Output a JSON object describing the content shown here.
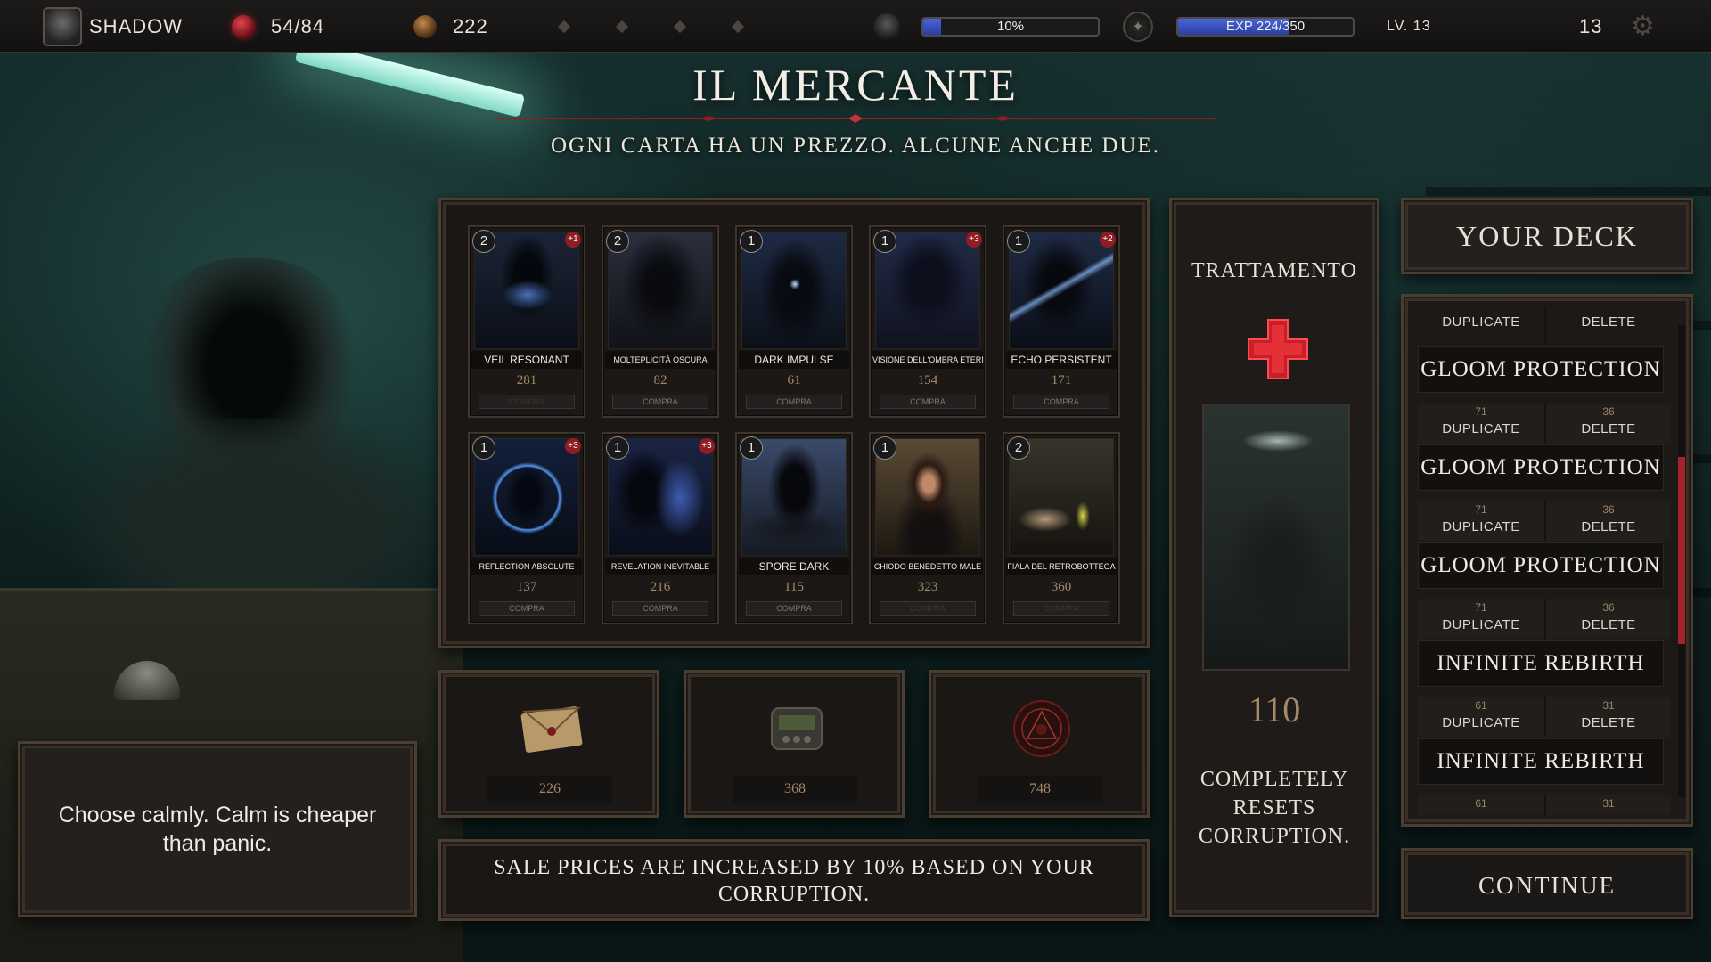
{
  "topbar": {
    "player_name": "SHADOW",
    "health": "54/84",
    "gold": "222",
    "corruption_label": "10%",
    "corruption_fraction": 0.1,
    "exp_label": "EXP 224/350",
    "exp_fraction": 0.64,
    "level_label": "LV. 13",
    "floor": "13",
    "icons": [
      "avatar",
      "heart-icon",
      "coin-icon",
      "diamond-icon",
      "mask-icon",
      "compass-icon",
      "gear-icon"
    ]
  },
  "header": {
    "title": "IL MERCANTE",
    "subtitle": "OGNI CARTA HA UN PREZZO. ALCUNE ANCHE DUE."
  },
  "shop": {
    "buy_label": "COMPRA",
    "cards": [
      {
        "name": "VEIL RESONANT",
        "cost": "2",
        "upgrade": "+1",
        "price": "281",
        "affordable": false,
        "art": "veil"
      },
      {
        "name": "MOLTEPLICITÀ OSCURA",
        "cost": "2",
        "upgrade": "",
        "price": "82",
        "affordable": true,
        "art": "shadow"
      },
      {
        "name": "DARK IMPULSE",
        "cost": "1",
        "upgrade": "",
        "price": "61",
        "affordable": true,
        "art": "impulse"
      },
      {
        "name": "VISIONE DELL'OMBRA ETERNA",
        "cost": "1",
        "upgrade": "+3",
        "price": "154",
        "affordable": true,
        "art": "vision"
      },
      {
        "name": "ECHO PERSISTENT",
        "cost": "1",
        "upgrade": "+2",
        "price": "171",
        "affordable": true,
        "art": "echo"
      },
      {
        "name": "REFLECTION ABSOLUTE",
        "cost": "1",
        "upgrade": "+3",
        "price": "137",
        "affordable": true,
        "art": "reflection"
      },
      {
        "name": "REVELATION INEVITABLE",
        "cost": "1",
        "upgrade": "+3",
        "price": "216",
        "affordable": true,
        "art": "revelation"
      },
      {
        "name": "SPORE DARK",
        "cost": "1",
        "upgrade": "",
        "price": "115",
        "affordable": true,
        "art": "spore"
      },
      {
        "name": "CHIODO BENEDETTO MALE",
        "cost": "1",
        "upgrade": "",
        "price": "323",
        "affordable": false,
        "art": "woman"
      },
      {
        "name": "FIALA DEL RETROBOTTEGA",
        "cost": "2",
        "upgrade": "",
        "price": "360",
        "affordable": false,
        "art": "vial"
      }
    ]
  },
  "relics": [
    {
      "name": "letter",
      "price": "226"
    },
    {
      "name": "pager",
      "price": "368"
    },
    {
      "name": "sigil",
      "price": "748"
    }
  ],
  "dialog": {
    "text": "Choose calmly. Calm is cheaper than panic."
  },
  "note": {
    "text": "SALE PRICES ARE INCREASED BY 10% BASED ON YOUR CORRUPTION."
  },
  "treatment": {
    "title": "TRATTAMENTO",
    "price": "110",
    "description": "COMPLETELY RESETS CORRUPTION."
  },
  "deck": {
    "title": "YOUR DECK",
    "duplicate_label": "DUPLICATE",
    "delete_label": "DELETE",
    "entries": [
      {
        "name": "GLOOM PROTECTION",
        "dup_price": "",
        "del_price": ""
      },
      {
        "name": "GLOOM PROTECTION",
        "dup_price": "71",
        "del_price": "36"
      },
      {
        "name": "GLOOM PROTECTION",
        "dup_price": "71",
        "del_price": "36"
      },
      {
        "name": "INFINITE REBIRTH",
        "dup_price": "71",
        "del_price": "36"
      },
      {
        "name": "INFINITE REBIRTH",
        "dup_price": "61",
        "del_price": "31"
      }
    ],
    "trailing_prices": {
      "dup_price": "61",
      "del_price": "31"
    }
  },
  "continue_label": "CONTINUE"
}
